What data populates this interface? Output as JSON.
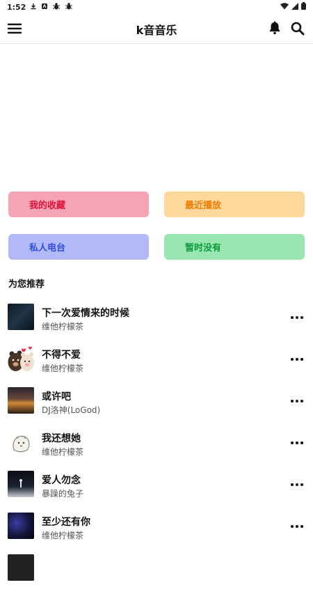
{
  "status_bar": {
    "time": "1:52"
  },
  "app_bar": {
    "title": "k音音乐"
  },
  "quick_actions": [
    {
      "label": "我的收藏",
      "color": "#f6a3b4",
      "text_color": "#e0103b"
    },
    {
      "label": "最近播放",
      "color": "#fcd89a",
      "text_color": "#f07d00"
    },
    {
      "label": "私人电台",
      "color": "#b3b9f6",
      "text_color": "#2d4fe0"
    },
    {
      "label": "暂时没有",
      "color": "#9ae6b3",
      "text_color": "#0a9a3a"
    }
  ],
  "recommend": {
    "title": "为您推荐",
    "songs": [
      {
        "title": "下一次爱情来的时候",
        "artist": "维他柠檬茶"
      },
      {
        "title": "不得不爱",
        "artist": "维他柠檬茶"
      },
      {
        "title": "或许吧",
        "artist": "DJ洛神(LoGod)"
      },
      {
        "title": "我还想她",
        "artist": "维他柠檬茶"
      },
      {
        "title": "爱人勿念",
        "artist": "暴躁的兔子"
      },
      {
        "title": "至少还有你",
        "artist": "维他柠檬茶"
      }
    ]
  }
}
